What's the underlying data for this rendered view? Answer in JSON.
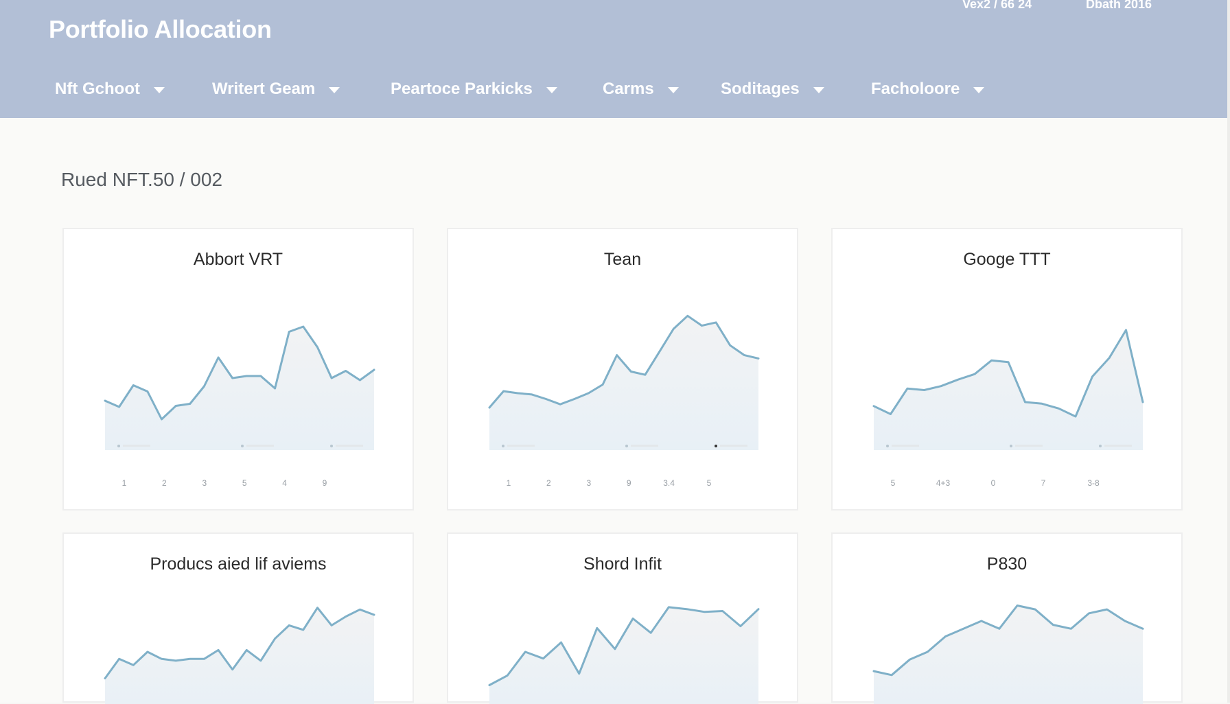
{
  "header": {
    "title": "Portfolio Allocation",
    "meta_left": "Vex2 / 66 24",
    "meta_right": "Dbath 2016",
    "nav": [
      {
        "label": "Nft Gchoot"
      },
      {
        "label": "Writert Geam"
      },
      {
        "label": "Peartoce Parkicks"
      },
      {
        "label": "Carms"
      },
      {
        "label": "Soditages"
      },
      {
        "label": "Facholoore"
      }
    ]
  },
  "main": {
    "subtitle": "Rued NFT.50 / 002"
  },
  "colors": {
    "header_bg": "#b2bfd6",
    "line": "#7fb0c8",
    "area_fill_top": "#f2f3f4",
    "area_fill_bottom": "#e8f0f6"
  },
  "chart_data": [
    {
      "type": "area",
      "title": "Abbort VRT",
      "x_tick_labels": [
        "1",
        "2",
        "3",
        "5",
        "4",
        "9"
      ],
      "legend": [
        "•",
        "•",
        "•"
      ],
      "values": [
        48,
        42,
        63,
        57,
        30,
        43,
        45,
        62,
        90,
        70,
        72,
        72,
        60,
        115,
        120,
        100,
        70,
        77,
        68,
        78
      ],
      "ylim": [
        0,
        140
      ]
    },
    {
      "type": "area",
      "title": "Tean",
      "x_tick_labels": [
        "1",
        "2",
        "3",
        "9",
        "3.4",
        "5"
      ],
      "legend": [
        "•",
        "•",
        "•"
      ],
      "values": [
        65,
        90,
        87,
        85,
        78,
        70,
        78,
        87,
        100,
        145,
        120,
        115,
        150,
        185,
        205,
        190,
        195,
        160,
        145,
        140
      ],
      "ylim": [
        0,
        220
      ]
    },
    {
      "type": "area",
      "title": "Googe TTT",
      "x_tick_labels": [
        "5",
        "4+3",
        "0",
        "7",
        "3-8"
      ],
      "legend": [
        "•",
        "•",
        "•"
      ],
      "values": [
        55,
        45,
        77,
        75,
        80,
        88,
        95,
        112,
        110,
        60,
        58,
        52,
        42,
        92,
        115,
        150,
        60
      ],
      "ylim": [
        0,
        180
      ]
    },
    {
      "type": "area",
      "title": "Producs aied lif aviems",
      "x_tick_labels": [],
      "legend": [],
      "values": [
        40,
        62,
        55,
        70,
        62,
        60,
        62,
        62,
        72,
        50,
        72,
        60,
        85,
        100,
        95,
        120,
        100,
        110,
        118,
        112
      ],
      "ylim": [
        0,
        140
      ]
    },
    {
      "type": "area",
      "title": "Shord Infit",
      "x_tick_labels": [],
      "legend": [],
      "values": [
        30,
        40,
        65,
        58,
        75,
        42,
        90,
        68,
        100,
        85,
        112,
        110,
        107,
        108,
        92,
        110
      ],
      "ylim": [
        0,
        130
      ]
    },
    {
      "type": "area",
      "title": "P830",
      "x_tick_labels": [],
      "legend": [],
      "values": [
        55,
        50,
        70,
        80,
        100,
        110,
        120,
        110,
        140,
        135,
        115,
        110,
        130,
        135,
        120,
        110
      ],
      "ylim": [
        0,
        160
      ]
    }
  ]
}
